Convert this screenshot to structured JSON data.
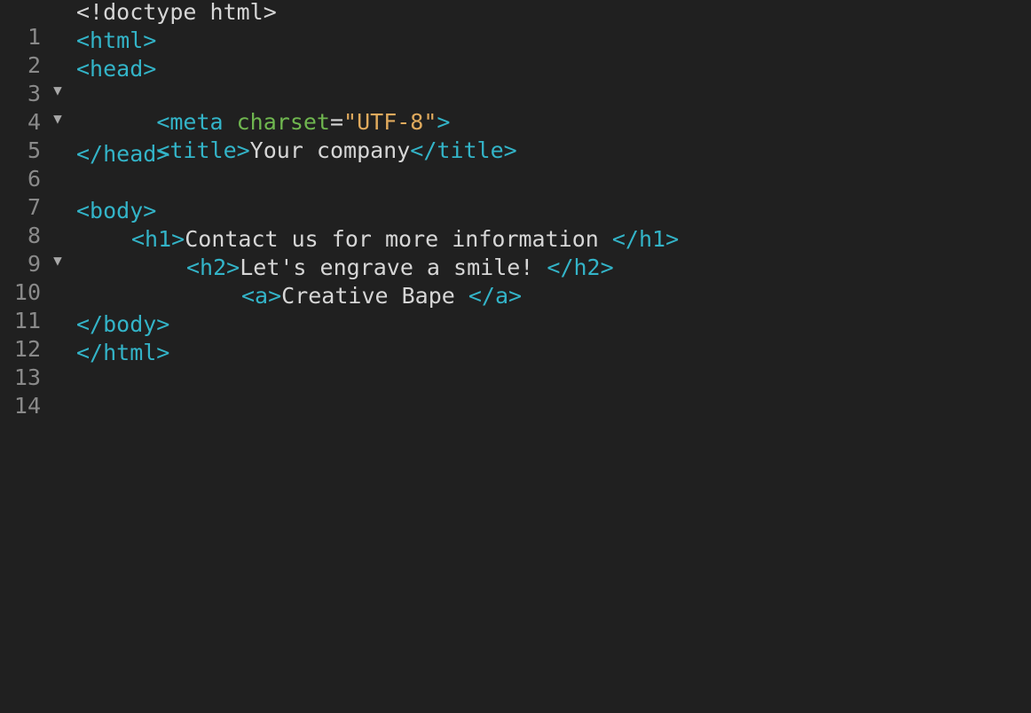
{
  "editor": {
    "lines": [
      {
        "number": "1",
        "code": "<!doctype html>"
      },
      {
        "number": "2",
        "fold": "▼",
        "code": "<html>"
      },
      {
        "number": "3",
        "fold": "▼",
        "code": "<head>"
      },
      {
        "number": "4",
        "code_parts": [
          "<meta ",
          "charset",
          "=",
          "\"UTF-8\"",
          ">"
        ]
      },
      {
        "number": "5",
        "code_parts": [
          "<title>",
          "Your company",
          "</title>"
        ]
      },
      {
        "number": "6",
        "code": "</head>"
      },
      {
        "number": "7",
        "code": ""
      },
      {
        "number": "8",
        "fold": "▼",
        "code": "<body>"
      },
      {
        "number": "9",
        "code_parts": [
          "<h1>",
          "Contact us for more information ",
          "</h1>"
        ]
      },
      {
        "number": "10",
        "code_parts": [
          "<h2>",
          "Let's engrave a smile! ",
          "</h2>"
        ]
      },
      {
        "number": "11",
        "code_parts": [
          "<a>",
          "Creative Bape ",
          "</a>"
        ]
      },
      {
        "number": "12",
        "code": "</body>"
      },
      {
        "number": "13",
        "code": "</html>"
      },
      {
        "number": "14",
        "code": ""
      }
    ]
  },
  "colors": {
    "background": "#202020",
    "tag": "#33b4c8",
    "attribute": "#6fb64f",
    "string": "#e0aa5d",
    "text": "#d6d6d6",
    "line_number": "#8a8a8a"
  },
  "icons": {
    "fold": "fold-triangle-icon"
  }
}
